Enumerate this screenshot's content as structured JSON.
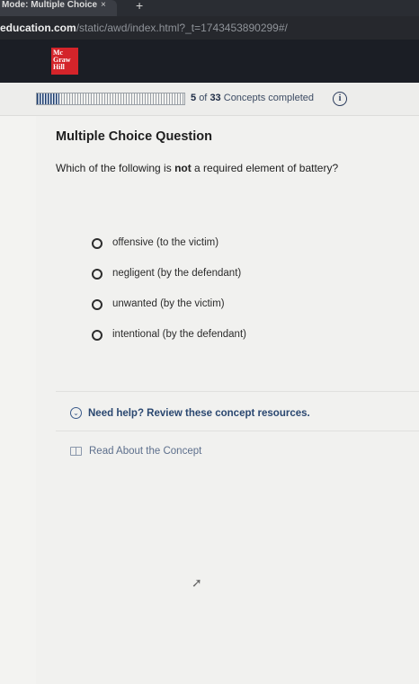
{
  "browser": {
    "tab_title": "Mode: Multiple Choice",
    "tab_close": "×",
    "new_tab": "+",
    "url_host": "education.com",
    "url_path": "/static/awd/index.html?_t=1743453890299#/"
  },
  "header": {
    "logo_lines": [
      "Mc",
      "Graw",
      "Hill"
    ],
    "logo_color": "#d4242a"
  },
  "progress": {
    "completed": "5",
    "total": "33",
    "fraction": 0.15,
    "label_suffix": "Concepts completed",
    "info_icon": "info-icon",
    "info_glyph": "i"
  },
  "question": {
    "type_title": "Multiple Choice Question",
    "text_before": "Which of the following is ",
    "text_emphasis": "not",
    "text_after": " a required element of battery?",
    "options": [
      "offensive (to the victim)",
      "negligent (by the defendant)",
      "unwanted (by the victim)",
      "intentional (by the defendant)"
    ]
  },
  "help": {
    "icon": "chevron-down-icon",
    "icon_glyph": "⌄",
    "label": "Need help? Review these concept resources."
  },
  "resource": {
    "icon": "book-icon",
    "label": "Read About the Concept"
  }
}
